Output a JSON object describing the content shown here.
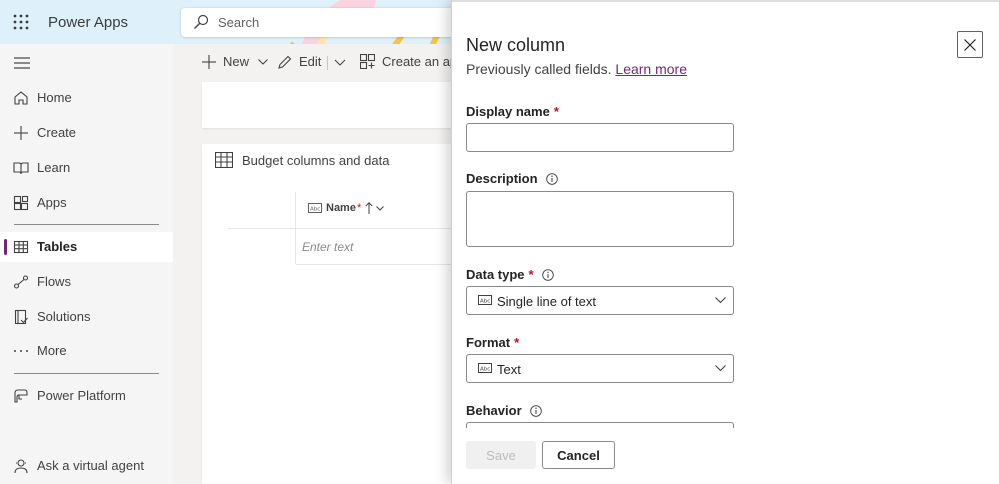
{
  "header": {
    "app_title": "Power Apps",
    "search_placeholder": "Search"
  },
  "sidebar": {
    "items": [
      {
        "label": "Home",
        "icon": "home-icon"
      },
      {
        "label": "Create",
        "icon": "plus-icon"
      },
      {
        "label": "Learn",
        "icon": "book-icon"
      },
      {
        "label": "Apps",
        "icon": "apps-icon"
      },
      {
        "label": "Tables",
        "icon": "table-icon",
        "selected": true
      },
      {
        "label": "Flows",
        "icon": "flow-icon"
      },
      {
        "label": "Solutions",
        "icon": "solutions-icon"
      },
      {
        "label": "More",
        "icon": "more-icon"
      },
      {
        "label": "Power Platform",
        "icon": "power-platform-icon"
      },
      {
        "label": "Ask a virtual agent",
        "icon": "agent-icon"
      }
    ]
  },
  "main": {
    "commands": {
      "new": "New",
      "edit": "Edit",
      "create_app": "Create an app"
    },
    "card_title": "Budget columns and data",
    "column_header": "Name",
    "cell_placeholder": "Enter text"
  },
  "panel": {
    "title": "New column",
    "subtitle": "Previously called fields.",
    "learn_more": "Learn more",
    "display_name_label": "Display name",
    "description_label": "Description",
    "data_type_label": "Data type",
    "data_type_value": "Single line of text",
    "format_label": "Format",
    "format_value": "Text",
    "behavior_label": "Behavior",
    "save_label": "Save",
    "cancel_label": "Cancel"
  },
  "colors": {
    "accent": "#742774",
    "header_bg": "#def1fa",
    "required": "#c50f1f"
  }
}
